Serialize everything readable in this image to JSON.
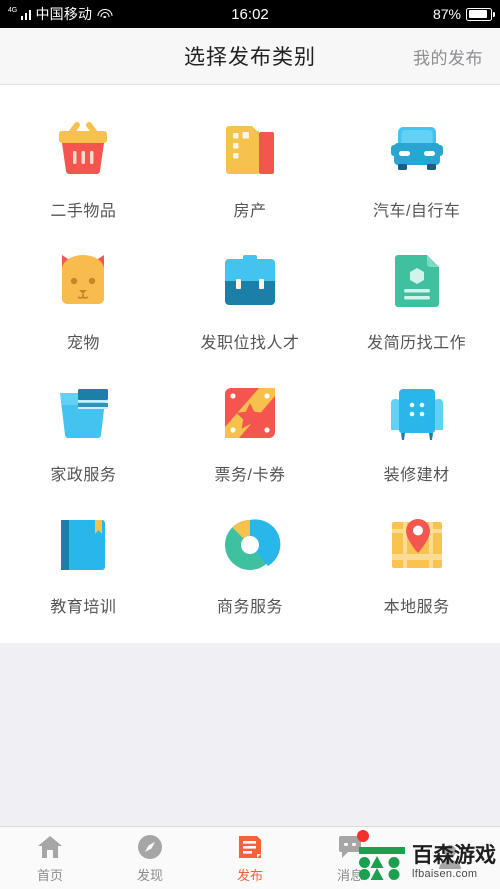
{
  "status_bar": {
    "network": "4G",
    "carrier": "中国移动",
    "wifi_icon": "wifi-icon",
    "time": "16:02",
    "battery_percent": "87%",
    "battery_level": 87
  },
  "header": {
    "title": "选择发布类别",
    "action_label": "我的发布"
  },
  "categories": [
    {
      "label": "二手物品",
      "icon": "shopping-basket-icon"
    },
    {
      "label": "房产",
      "icon": "building-icon"
    },
    {
      "label": "汽车/自行车",
      "icon": "car-icon"
    },
    {
      "label": "宠物",
      "icon": "cat-icon"
    },
    {
      "label": "发职位找人才",
      "icon": "briefcase-icon"
    },
    {
      "label": "发简历找工作",
      "icon": "resume-document-icon"
    },
    {
      "label": "家政服务",
      "icon": "bucket-towel-icon"
    },
    {
      "label": "票务/卡券",
      "icon": "ticket-star-icon"
    },
    {
      "label": "装修建材",
      "icon": "armchair-icon"
    },
    {
      "label": "教育培训",
      "icon": "book-icon"
    },
    {
      "label": "商务服务",
      "icon": "donut-chart-icon"
    },
    {
      "label": "本地服务",
      "icon": "map-pin-icon"
    }
  ],
  "tabbar": [
    {
      "label": "首页",
      "icon": "home-icon",
      "active": false,
      "badge": false
    },
    {
      "label": "发现",
      "icon": "compass-icon",
      "active": false,
      "badge": false
    },
    {
      "label": "发布",
      "icon": "publish-icon",
      "active": true,
      "badge": false
    },
    {
      "label": "消息",
      "icon": "chat-icon",
      "active": false,
      "badge": true
    },
    {
      "label": "",
      "icon": "person-icon",
      "active": false,
      "badge": false
    }
  ],
  "watermark": {
    "logo_icon": "baisen-logo-icon",
    "name": "百森游戏",
    "url": "lfbaisen.com"
  },
  "colors": {
    "accent": "#f4613c",
    "yellow": "#f7c24b",
    "red": "#f4564f",
    "blue_light": "#45c3f0",
    "blue_dark": "#1b7fa8",
    "teal": "#3fc1a0",
    "header_bg": "#f7f7f7",
    "page_bg": "#efeff4",
    "badge": "#f4302a",
    "watermark_green": "#1d9f50"
  }
}
